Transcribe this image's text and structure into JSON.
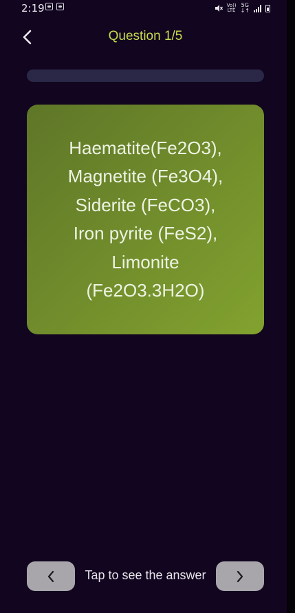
{
  "status_bar": {
    "time": "2:19",
    "left_icons": [
      "scan-icon",
      "scan-icon"
    ],
    "right_icons": [
      "mute-icon",
      "volte-icon",
      "5g-icon",
      "signal-icon",
      "battery-icon"
    ],
    "volte_label_top": "Vo))",
    "volte_label_bottom": "LTE",
    "net_label": "5G",
    "net_label_bottom": "↓↑"
  },
  "header": {
    "back_icon": "chevron-left-icon",
    "title": "Question 1/5"
  },
  "progress": {
    "current": 1,
    "total": 5,
    "fraction": 0
  },
  "card": {
    "lines": [
      "Haematite(Fe2O3),",
      "Magnetite (Fe3O4),",
      "Siderite (FeCO3),",
      "Iron pyrite (FeS2),",
      "Limonite",
      "(Fe2O3.3H2O)"
    ],
    "gradient_start": "#5e7628",
    "gradient_end": "#82a22f"
  },
  "footer": {
    "prev_icon": "chevron-left-icon",
    "hint": "Tap to see the answer",
    "next_icon": "chevron-right-icon"
  },
  "colors": {
    "background": "#12051f",
    "accent": "#c5dc4f",
    "track": "#2b2847",
    "button": "#a8a6ab"
  }
}
